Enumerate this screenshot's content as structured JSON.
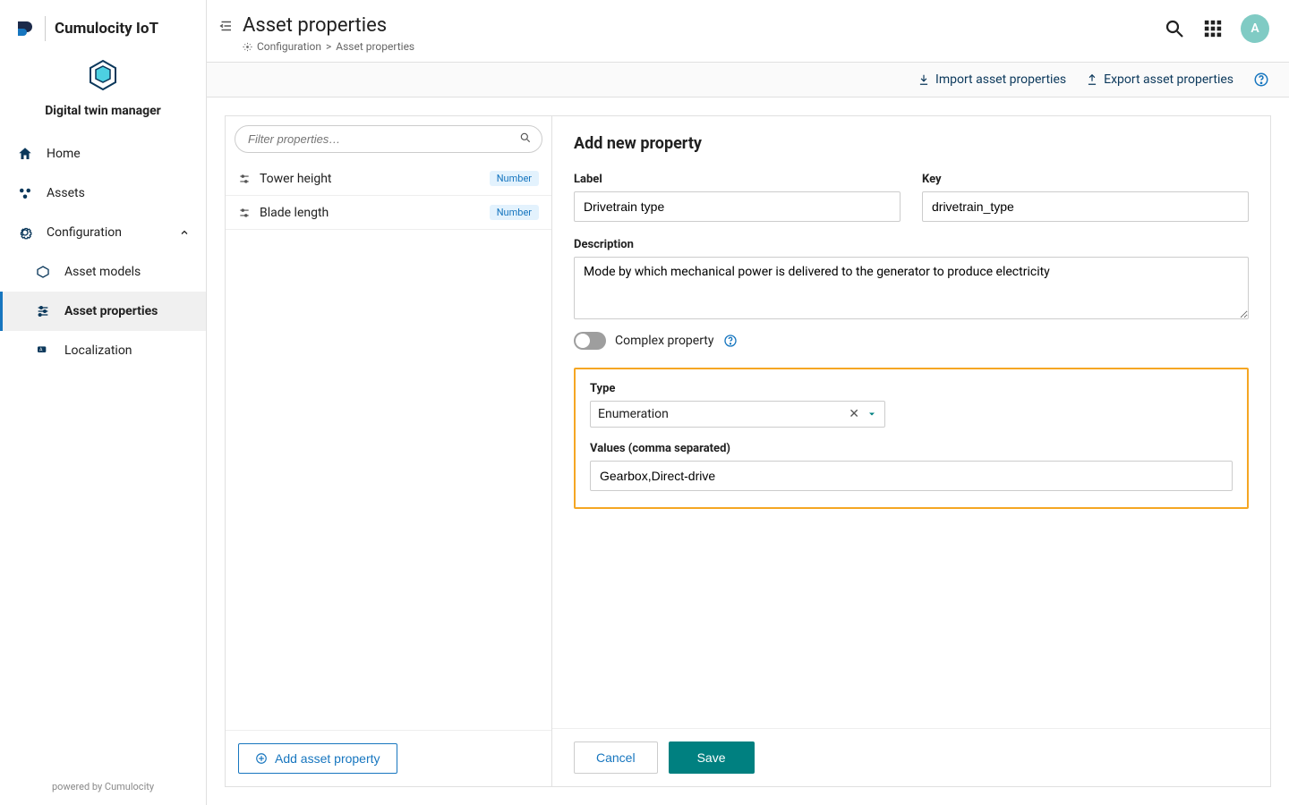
{
  "brand": "Cumulocity IoT",
  "app_title": "Digital twin manager",
  "nav": {
    "home": "Home",
    "assets": "Assets",
    "configuration": "Configuration",
    "asset_models": "Asset models",
    "asset_properties": "Asset properties",
    "localization": "Localization"
  },
  "page": {
    "title": "Asset properties",
    "breadcrumb_root": "Configuration",
    "breadcrumb_current": "Asset properties"
  },
  "avatar_initial": "A",
  "actionbar": {
    "import": "Import asset properties",
    "export": "Export asset properties"
  },
  "filter_placeholder": "Filter properties…",
  "properties_list": [
    {
      "label": "Tower height",
      "badge": "Number"
    },
    {
      "label": "Blade length",
      "badge": "Number"
    }
  ],
  "add_asset_property_btn": "Add asset property",
  "form": {
    "title": "Add new property",
    "label_label": "Label",
    "label_value": "Drivetrain type",
    "key_label": "Key",
    "key_value": "drivetrain_type",
    "description_label": "Description",
    "description_value": "Mode by which mechanical power is delivered to the generator to produce electricity",
    "complex_label": "Complex property",
    "type_label": "Type",
    "type_value": "Enumeration",
    "values_label": "Values (comma separated)",
    "values_value": "Gearbox,Direct-drive",
    "cancel": "Cancel",
    "save": "Save"
  },
  "footer": "powered by Cumulocity"
}
